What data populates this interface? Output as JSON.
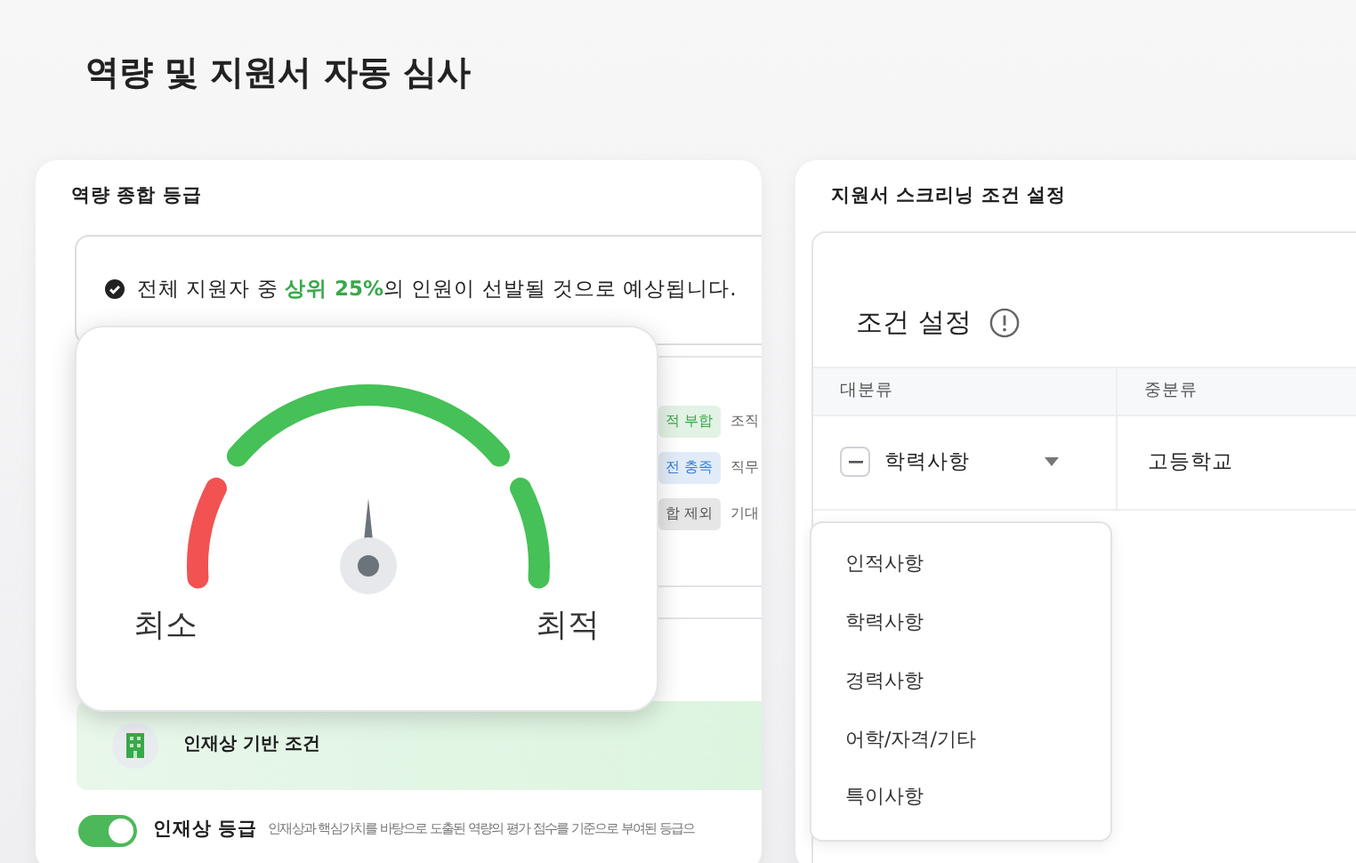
{
  "page_title": "역량 및 지원서 자동 심사",
  "grade_panel": {
    "title": "역량 종합 등급",
    "summary": "전체 지원자 중 **상위 25%**의 인원이 선발될 것으로 예상됩니다.",
    "behind_rows": [
      {
        "tag": "적 부합",
        "color": "#3aa84a",
        "text": "조직"
      },
      {
        "tag": "전 충족",
        "color": "#3b7fd0",
        "text": "직무"
      },
      {
        "tag": "합 제외",
        "color": "#555555",
        "text": "기대"
      }
    ],
    "gauge": {
      "level": 0.5,
      "min_label": "최소",
      "max_label": "최적"
    },
    "banner": {
      "label": "인재상 기반 조건"
    },
    "toggle": {
      "on": true,
      "label": "인재상 등급",
      "description": "인재상과 핵심가치를 바탕으로 도출된 역량의 평가 점수를 기준으로 부여된 등급으"
    }
  },
  "screening_panel": {
    "title": "지원서 스크리닝 조건 설정",
    "section_title": "조건 설정",
    "columns": [
      "대분류",
      "중분류"
    ],
    "row": {
      "category": "학력사항",
      "subcategory": "고등학교"
    },
    "dropdown": [
      {
        "label": "인적사항",
        "selected": false
      },
      {
        "label": "학력사항",
        "selected": false
      },
      {
        "label": "경력사항",
        "selected": false
      },
      {
        "label": "어학/자격/기타",
        "selected": false
      },
      {
        "label": "특이사항",
        "selected": false
      }
    ]
  }
}
